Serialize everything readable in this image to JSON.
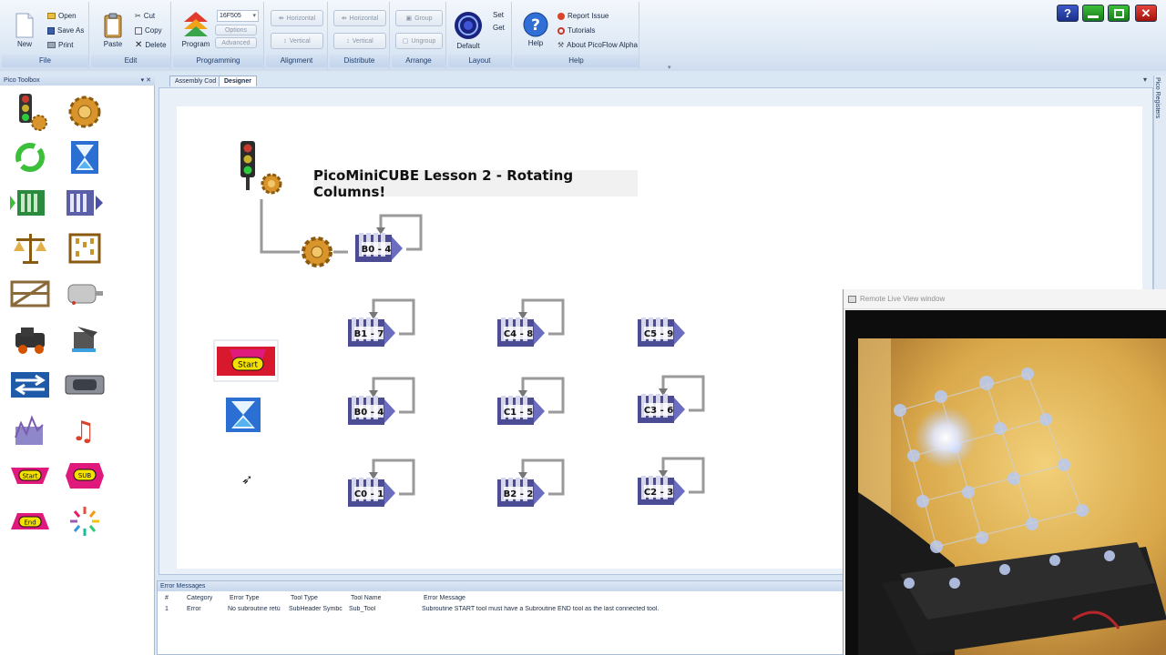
{
  "ribbon": {
    "file": {
      "label": "File",
      "new": "New",
      "open": "Open",
      "save_as": "Save As",
      "print": "Print"
    },
    "edit": {
      "label": "Edit",
      "paste": "Paste",
      "cut": "Cut",
      "copy": "Copy",
      "delete": "Delete"
    },
    "programming": {
      "label": "Programming",
      "program": "Program",
      "chip": "16F505",
      "options": "Options",
      "advanced": "Advanced"
    },
    "alignment": {
      "label": "Alignment",
      "horizontal": "Horizontal",
      "vertical": "Vertical"
    },
    "distribute": {
      "label": "Distribute",
      "horizontal": "Horizontal",
      "vertical": "Vertical"
    },
    "arrange": {
      "label": "Arrange",
      "group": "Group",
      "ungroup": "Ungroup"
    },
    "layout": {
      "label": "Layout",
      "default": "Default",
      "set": "Set",
      "get": "Get"
    },
    "help": {
      "label": "Help",
      "help": "Help",
      "report_issue": "Report Issue",
      "tutorials": "Tutorials",
      "about": "About PicoFlow Alpha"
    }
  },
  "toolbox": {
    "title": "Pico Toolbox",
    "start_label": "Start",
    "sub_label": "SUB",
    "end_label": "End"
  },
  "tabs": [
    "Assembly Cod",
    "Designer"
  ],
  "right_rail": "Pico Registers",
  "canvas": {
    "title": "PicoMiniCUBE Lesson 2 - Rotating Columns!",
    "start_label": "Start",
    "blocks": [
      "B0 - 4",
      "B1 - 7",
      "C4 - 8",
      "C5 - 9",
      "B0 - 4",
      "C1 - 5",
      "C3 - 6",
      "C0 - 1",
      "B2 - 2",
      "C2 - 3"
    ]
  },
  "errors": {
    "title": "Error Messages",
    "columns": [
      "#",
      "Category",
      "Error Type",
      "Tool Type",
      "Tool Name",
      "Error Message"
    ],
    "rows": [
      [
        "1",
        "Error",
        "No subroutine retú",
        "SubHeader Symbc",
        "Sub_Tool",
        "Subroutine START tool must have a Subroutine END tool as the last connected tool."
      ]
    ]
  },
  "live_view": {
    "title": "Remote Live View window"
  },
  "colors": {
    "accent": "#1d3d6b",
    "start_red": "#d8182c",
    "start_yellow": "#f4e100",
    "sub_pink": "#e0197d"
  }
}
